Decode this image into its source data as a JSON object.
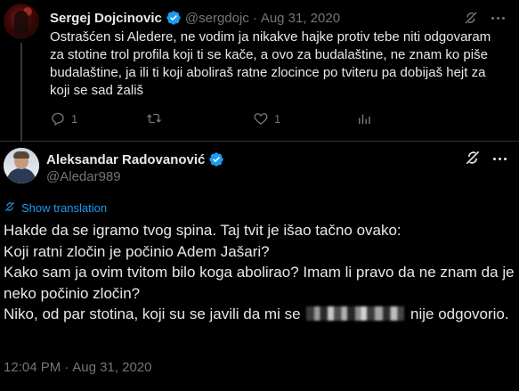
{
  "reply": {
    "author_name": "Sergej Dojcinovic",
    "handle": "@sergdojc",
    "separator": "·",
    "date": "Aug 31, 2020",
    "text": "Ostrašćen si Aledere, ne vodim ja nikakve hajke protiv tebe niti odgovaram za stotine trol profila koji ti se kače, a ovo za budalaštine, ne znam ko piše budalaštine, ja ili ti koji aboliraš ratne zlocince po tviteru pa dobijaš hejt za koji se sad žališ",
    "actions": {
      "reply_count": "1",
      "retweet_count": "",
      "like_count": "1",
      "views_count": ""
    }
  },
  "main_tweet": {
    "author_name": "Aleksandar Radovanović",
    "handle": "@Aledar989",
    "translate_label": "Show translation",
    "lines": [
      "Hakde da se igramo tvog spina. Taj tvit je išao tačno ovako:",
      "Koji ratni zločin je počinio Adem Jašari?",
      "Kako sam ja ovim tvitom bilo koga abolirao? Imam li pravo da ne znam da je neko počinio zločin?"
    ],
    "last_line_before": "Niko, od par stotina, koji su se javili da mi se",
    "last_line_after": "nije odgovorio.",
    "time": "12:04 PM",
    "separator": "·",
    "date": "Aug 31, 2020"
  },
  "icons": {
    "verified": "verified-badge-icon",
    "grok": "grok-icon",
    "more": "more-options-icon",
    "reply": "reply-icon",
    "retweet": "retweet-icon",
    "like": "like-icon",
    "views": "views-icon",
    "translate": "translate-icon"
  },
  "colors": {
    "background": "#000000",
    "text": "#e7e9ea",
    "muted": "#71767b",
    "accent": "#1d9bf0",
    "divider": "#2f3336"
  }
}
